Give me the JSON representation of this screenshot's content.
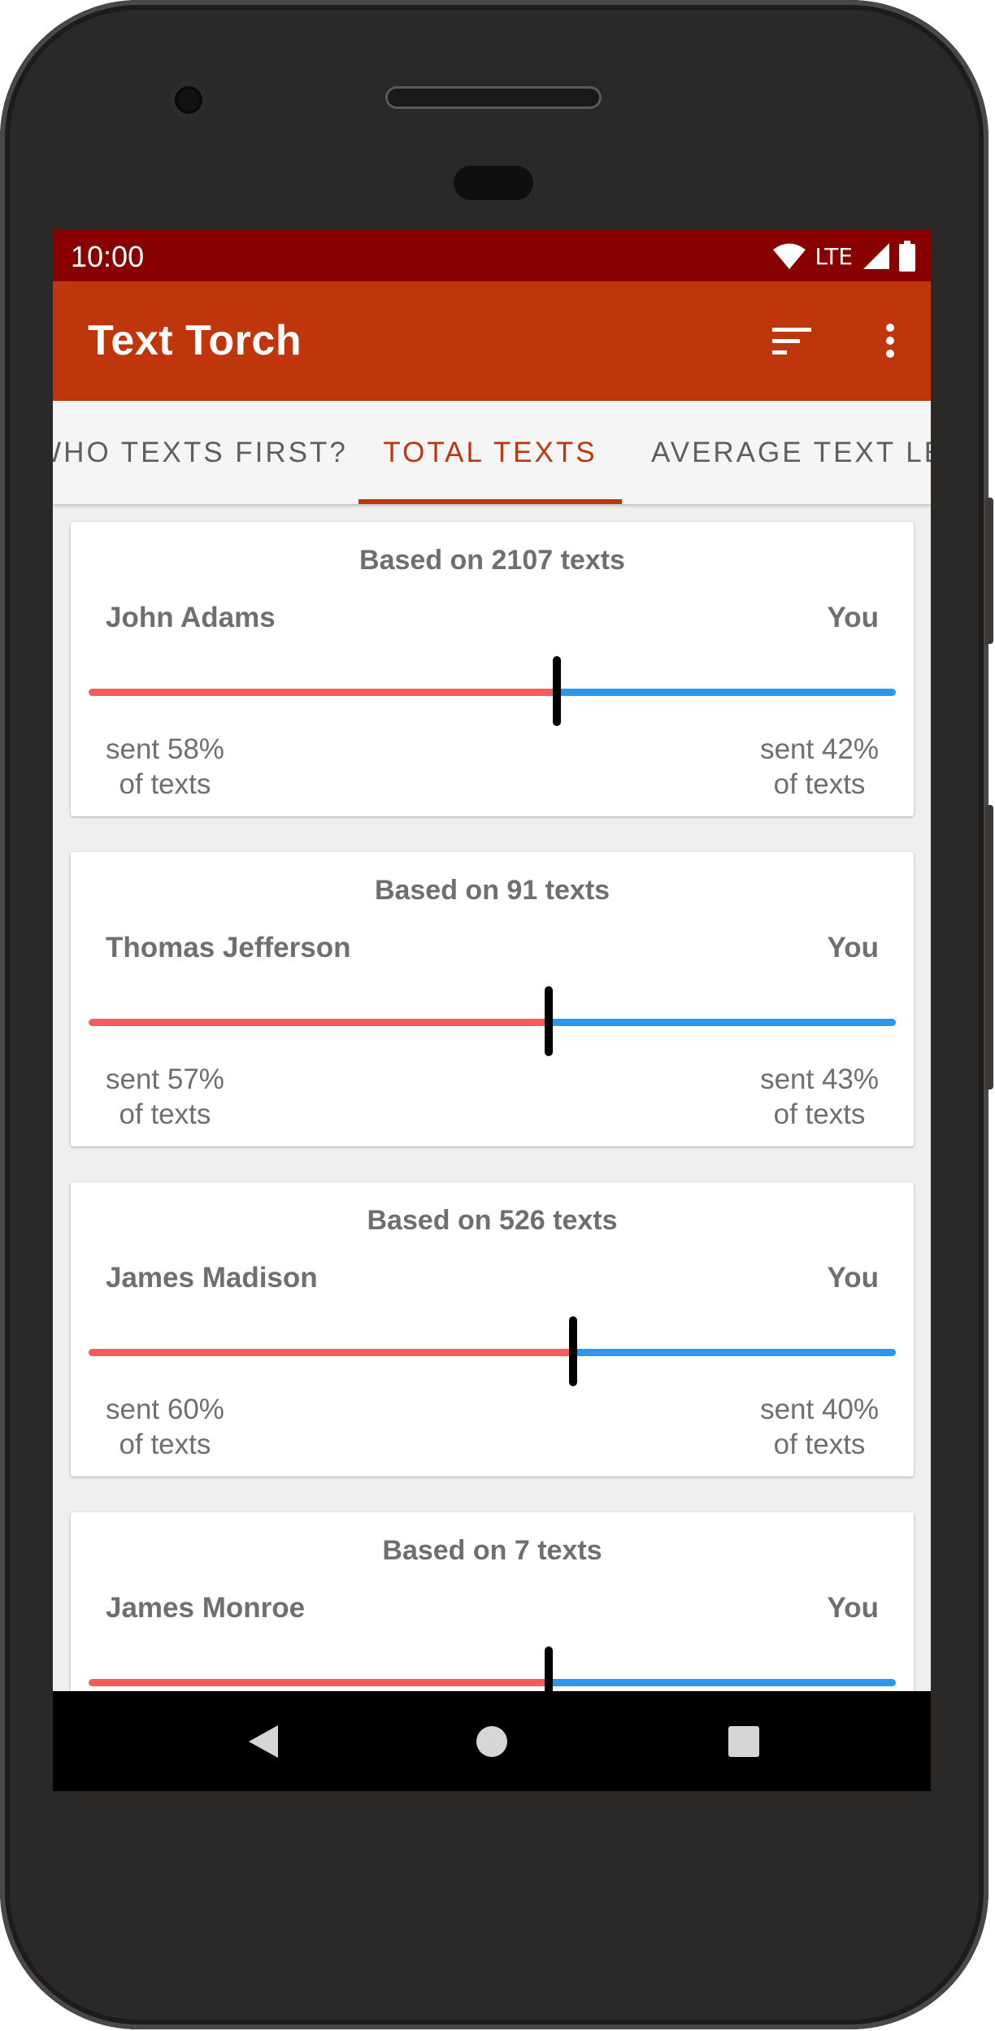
{
  "status_bar": {
    "time": "10:00",
    "network": "LTE"
  },
  "app_bar": {
    "title": "Text Torch",
    "sort_icon": "sort-icon",
    "more_icon": "more-vert-icon"
  },
  "tabs": [
    {
      "label": "WHO TEXTS FIRST?",
      "selected": false
    },
    {
      "label": "TOTAL TEXTS",
      "selected": true
    },
    {
      "label": "AVERAGE TEXT LENGTH",
      "selected": false
    }
  ],
  "cards": [
    {
      "based_on": "Based on 2107 texts",
      "contact": "John Adams",
      "you": "You",
      "contact_share": 0.58,
      "left_line1": "sent 58%",
      "left_line2": "of texts",
      "right_line1": "sent 42%",
      "right_line2": "of texts"
    },
    {
      "based_on": "Based on 91 texts",
      "contact": "Thomas Jefferson",
      "you": "You",
      "contact_share": 0.57,
      "left_line1": "sent 57%",
      "left_line2": "of texts",
      "right_line1": "sent 43%",
      "right_line2": "of texts"
    },
    {
      "based_on": "Based on 526 texts",
      "contact": "James Madison",
      "you": "You",
      "contact_share": 0.6,
      "left_line1": "sent 60%",
      "left_line2": "of texts",
      "right_line1": "sent 40%",
      "right_line2": "of texts"
    },
    {
      "based_on": "Based on 7 texts",
      "contact": "James Monroe",
      "you": "You",
      "contact_share": 0.57,
      "left_line1": "",
      "left_line2": "",
      "right_line1": "",
      "right_line2": ""
    }
  ],
  "colors": {
    "status_bar": "#880000",
    "app_bar": "#bf360c",
    "accent": "#bf360c",
    "contact_bar": "#f75b5b",
    "you_bar": "#2c97ec"
  },
  "nav": {
    "back_icon": "back-triangle-icon",
    "home_icon": "home-circle-icon",
    "recents_icon": "recents-square-icon"
  }
}
